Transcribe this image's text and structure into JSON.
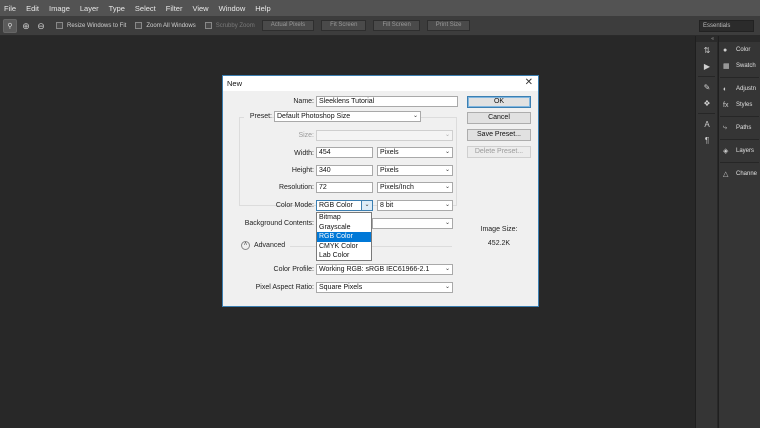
{
  "menubar": [
    "File",
    "Edit",
    "Image",
    "Layer",
    "Type",
    "Select",
    "Filter",
    "View",
    "Window",
    "Help"
  ],
  "options": {
    "resize_windows": "Resize Windows to Fit",
    "zoom_all": "Zoom All Windows",
    "scrubby": "Scrubby Zoom",
    "actual_pixels": "Actual Pixels",
    "fit_screen": "Fit Screen",
    "fill_screen": "Fill Screen",
    "print_size": "Print Size",
    "workspace": "Essentials"
  },
  "panels": {
    "color": "Color",
    "swatches": "Swatch",
    "adjustments": "Adjustn",
    "styles": "Styles",
    "paths": "Paths",
    "layers": "Layers",
    "channels": "Channe"
  },
  "dialog": {
    "title": "New",
    "name_label": "Name:",
    "name_value": "Sleeklens Tutorial",
    "preset_label": "Preset:",
    "preset_value": "Default Photoshop Size",
    "size_label": "Size:",
    "width_label": "Width:",
    "width_value": "454",
    "width_unit": "Pixels",
    "height_label": "Height:",
    "height_value": "340",
    "height_unit": "Pixels",
    "resolution_label": "Resolution:",
    "resolution_value": "72",
    "resolution_unit": "Pixels/Inch",
    "color_mode_label": "Color Mode:",
    "color_mode_value": "RGB Color",
    "bit_depth": "8 bit",
    "bg_label": "Background Contents:",
    "advanced": "Advanced",
    "color_profile_label": "Color Profile:",
    "color_profile_value": "Working RGB:  sRGB IEC61966-2.1",
    "aspect_label": "Pixel Aspect Ratio:",
    "aspect_value": "Square Pixels",
    "ok": "OK",
    "cancel": "Cancel",
    "save_preset": "Save Preset...",
    "delete_preset": "Delete Preset...",
    "image_size_label": "Image Size:",
    "image_size_value": "452.2K",
    "color_mode_options": [
      "Bitmap",
      "Grayscale",
      "RGB Color",
      "CMYK Color",
      "Lab Color"
    ]
  }
}
